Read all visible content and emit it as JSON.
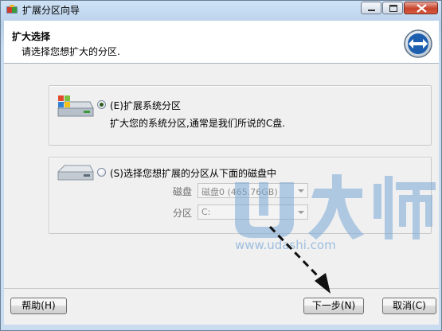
{
  "window": {
    "title": "扩展分区向导"
  },
  "header": {
    "title": "扩大选择",
    "subtitle": "请选择您想扩大的分区."
  },
  "option1": {
    "label": "(E)扩展系统分区",
    "description": "扩大您的系统分区,通常是我们所说的C盘.",
    "selected": true
  },
  "option2": {
    "label": "(S)选择您想扩展的分区从下面的磁盘中",
    "selected": false,
    "disk_label": "磁盘",
    "disk_value": "磁盘0 (465.76GB)",
    "partition_label": "分区",
    "partition_value": "C:"
  },
  "buttons": {
    "help": "帮助(H)",
    "next": "下一步(N)",
    "cancel": "取消(C)"
  },
  "watermark": {
    "brand": "U大师",
    "url": "www.udashi.com"
  },
  "colors": {
    "accent": "#1f6fc4",
    "watermark": "#7aa9d8"
  }
}
